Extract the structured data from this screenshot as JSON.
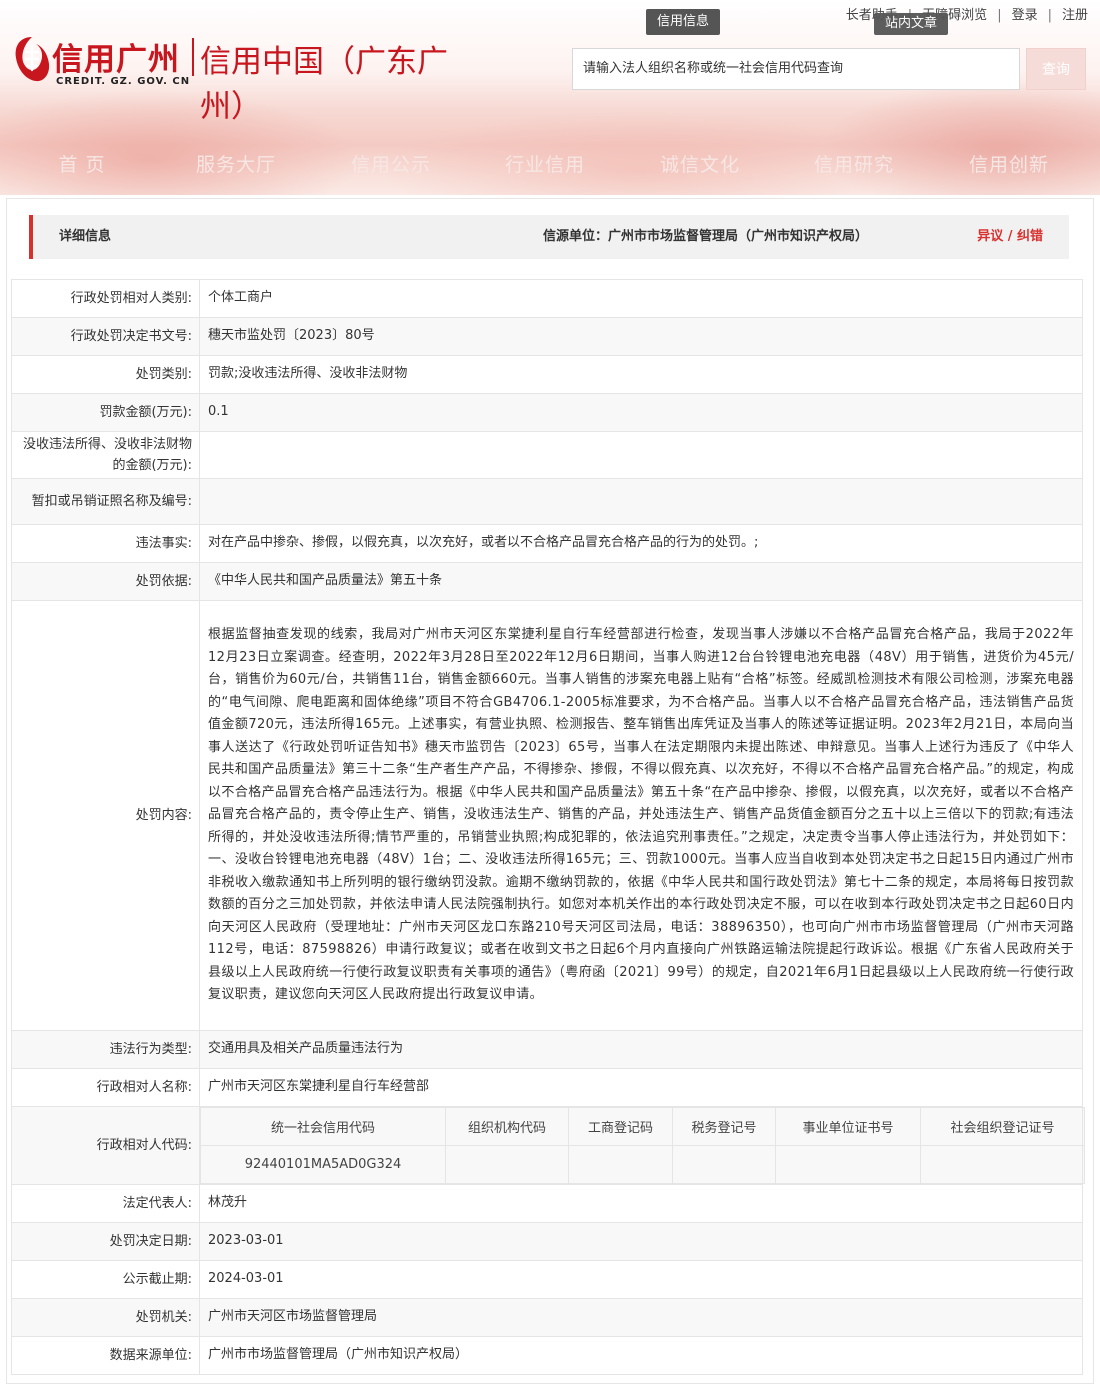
{
  "header": {
    "logo_main": "信用广州",
    "logo_sub": "CREDIT. GZ. GOV. CN",
    "logo_title": "信用中国（广东广州）",
    "top_links": [
      "长者助手",
      "无障碍浏览",
      "登录",
      "注册"
    ],
    "tag_xinyong": "信用信息",
    "tag_zhannei": "站内文章",
    "search_placeholder": "请输入法人组织名称或统一社会信用代码查询",
    "search_button": "查询",
    "nav": [
      "首 页",
      "服务大厅",
      "信用公示",
      "行业信用",
      "诚信文化",
      "信用研究",
      "信用创新"
    ]
  },
  "detail": {
    "title": "详细信息",
    "source": "信源单位：广州市市场监督管理局（广州市知识产权局）",
    "objection": "异议 / 纠错"
  },
  "rows": [
    {
      "label": "行政处罚相对人类别:",
      "value": "个体工商户"
    },
    {
      "label": "行政处罚决定书文号:",
      "value": "穗天市监处罚〔2023〕80号"
    },
    {
      "label": "处罚类别:",
      "value": "罚款;没收违法所得、没收非法财物"
    },
    {
      "label": "罚款金额(万元):",
      "value": "0.1"
    },
    {
      "label": "没收违法所得、没收非法财物的金额(万元):",
      "value": ""
    },
    {
      "label": "暂扣或吊销证照名称及编号:",
      "value": ""
    },
    {
      "label": "违法事实:",
      "value": "对在产品中掺杂、掺假，以假充真，以次充好，或者以不合格产品冒充合格产品的行为的处罚。;"
    },
    {
      "label": "处罚依据:",
      "value": "《中华人民共和国产品质量法》第五十条"
    },
    {
      "label": "处罚内容:",
      "value": "根据监督抽查发现的线索，我局对广州市天河区东棠捷利星自行车经营部进行检查，发现当事人涉嫌以不合格产品冒充合格产品，我局于2022年12月23日立案调查。经查明，2022年3月28日至2022年12月6日期间，当事人购进12台台铃锂电池充电器（48V）用于销售，进货价为45元/台，销售价为60元/台，共销售11台，销售金额660元。当事人销售的涉案充电器上贴有“合格”标签。经威凯检测技术有限公司检测，涉案充电器的“电气间隙、爬电距离和固体绝缘”项目不符合GB4706.1-2005标准要求，为不合格产品。当事人以不合格产品冒充合格产品，违法销售产品货值金额720元，违法所得165元。上述事实，有营业执照、检测报告、整车销售出库凭证及当事人的陈述等证据证明。2023年2月21日，本局向当事人送达了《行政处罚听证告知书》穗天市监罚告〔2023〕65号，当事人在法定期限内未提出陈述、申辩意见。当事人上述行为违反了《中华人民共和国产品质量法》第三十二条“生产者生产产品，不得掺杂、掺假，不得以假充真、以次充好，不得以不合格产品冒充合格产品。”的规定，构成以不合格产品冒充合格产品违法行为。根据《中华人民共和国产品质量法》第五十条“在产品中掺杂、掺假，以假充真，以次充好，或者以不合格产品冒充合格产品的，责令停止生产、销售，没收违法生产、销售的产品，并处违法生产、销售产品货值金额百分之五十以上三倍以下的罚款;有违法所得的，并处没收违法所得;情节严重的，吊销营业执照;构成犯罪的，依法追究刑事责任。”之规定，决定责令当事人停止违法行为，并处罚如下：一、没收台铃锂电池充电器（48V）1台；二、没收违法所得165元；三、罚款1000元。当事人应当自收到本处罚决定书之日起15日内通过广州市非税收入缴款通知书上所列明的银行缴纳罚没款。逾期不缴纳罚款的，依据《中华人民共和国行政处罚法》第七十二条的规定，本局将每日按罚款数额的百分之三加处罚款，并依法申请人民法院强制执行。如您对本机关作出的本行政处罚决定不服，可以在收到本行政处罚决定书之日起60日内向天河区人民政府（受理地址：广州市天河区龙口东路210号天河区司法局，电话：38896350），也可向广州市市场监督管理局（广州市天河路112号，电话：87598826）申请行政复议；或者在收到文书之日起6个月内直接向广州铁路运输法院提起行政诉讼。根据《广东省人民政府关于县级以上人民政府统一行使行政复议职责有关事项的通告》（粤府函〔2021〕99号）的规定，自2021年6月1日起县级以上人民政府统一行使行政复议职责，建议您向天河区人民政府提出行政复议申请。"
    },
    {
      "label": "违法行为类型:",
      "value": "交通用具及相关产品质量违法行为"
    },
    {
      "label": "行政相对人名称:",
      "value": "广州市天河区东棠捷利星自行车经营部"
    }
  ],
  "codes": {
    "label": "行政相对人代码:",
    "headers": [
      "统一社会信用代码",
      "组织机构代码",
      "工商登记码",
      "税务登记号",
      "事业单位证书号",
      "社会组织登记证号"
    ],
    "values": [
      "92440101MA5AD0G324",
      "",
      "",
      "",
      "",
      ""
    ]
  },
  "rows_after": [
    {
      "label": "法定代表人:",
      "value": "林茂升"
    },
    {
      "label": "处罚决定日期:",
      "value": "2023-03-01"
    },
    {
      "label": "公示截止期:",
      "value": "2024-03-01"
    },
    {
      "label": "处罚机关:",
      "value": "广州市天河区市场监督管理局"
    },
    {
      "label": "数据来源单位:",
      "value": "广州市市场监督管理局（广州市知识产权局）"
    }
  ],
  "colors": {
    "accent": "#d9302e",
    "brand": "#c8161e"
  }
}
